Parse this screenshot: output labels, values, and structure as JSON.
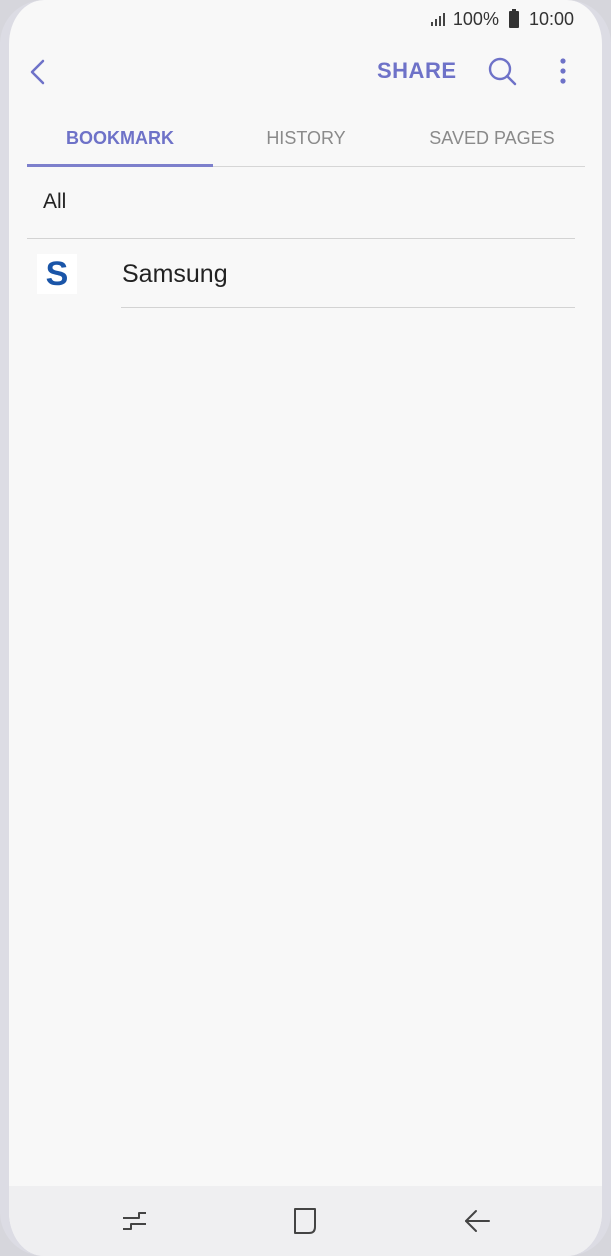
{
  "status_bar": {
    "battery_percent": "100%",
    "time": "10:00"
  },
  "app_bar": {
    "share_label": "SHARE"
  },
  "tabs": [
    {
      "label": "BOOKMARK",
      "active": true
    },
    {
      "label": "HISTORY",
      "active": false
    },
    {
      "label": "SAVED PAGES",
      "active": false
    }
  ],
  "folder": {
    "label": "All"
  },
  "bookmarks": [
    {
      "title": "Samsung",
      "favicon_letter": "S"
    }
  ],
  "colors": {
    "accent": "#6e72c8",
    "samsung_blue": "#1a55a8",
    "background": "#f8f8f8"
  },
  "icons": {
    "back": "back-arrow-icon",
    "search": "search-icon",
    "more": "more-vertical-icon",
    "recent_apps": "recent-apps-icon",
    "home": "home-icon",
    "nav_back": "nav-back-icon"
  }
}
